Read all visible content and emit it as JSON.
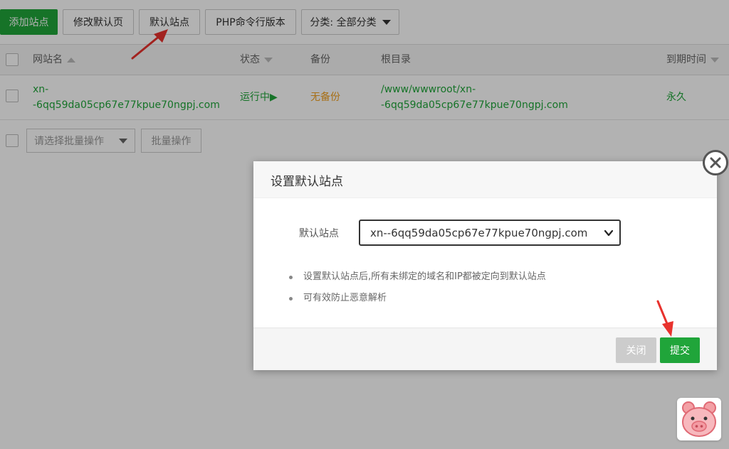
{
  "toolbar": {
    "add_site": "添加站点",
    "edit_default_page": "修改默认页",
    "default_site": "默认站点",
    "php_cli_version": "PHP命令行版本",
    "category_filter": "分类: 全部分类"
  },
  "table": {
    "headers": {
      "site_name": "网站名",
      "status": "状态",
      "backup": "备份",
      "root_dir": "根目录",
      "expire": "到期时间"
    },
    "row": {
      "site_line1": "xn-",
      "site_line2": "-6qq59da05cp67e77kpue70ngpj.com",
      "status": "运行中▶",
      "backup": "无备份",
      "root_line1": "/www/wwwroot/xn-",
      "root_line2": "-6qq59da05cp67e77kpue70ngpj.com",
      "expire": "永久"
    },
    "batch_select_placeholder": "请选择批量操作",
    "batch_button": "批量操作"
  },
  "modal": {
    "title": "设置默认站点",
    "field_label": "默认站点",
    "selected_site": "xn--6qq59da05cp67e77kpue70ngpj.com",
    "tips": [
      "设置默认站点后,所有未绑定的域名和IP都被定向到默认站点",
      "可有效防止恶意解析"
    ],
    "close_button": "关闭",
    "submit_button": "提交"
  },
  "colors": {
    "brand_green": "#20a53a",
    "warning_orange": "#f0a020",
    "annotation_red": "#e8322d"
  },
  "icons": {
    "close": "close-icon",
    "select_chevron": "chevron-down-icon",
    "mascot": "pig-icon"
  }
}
